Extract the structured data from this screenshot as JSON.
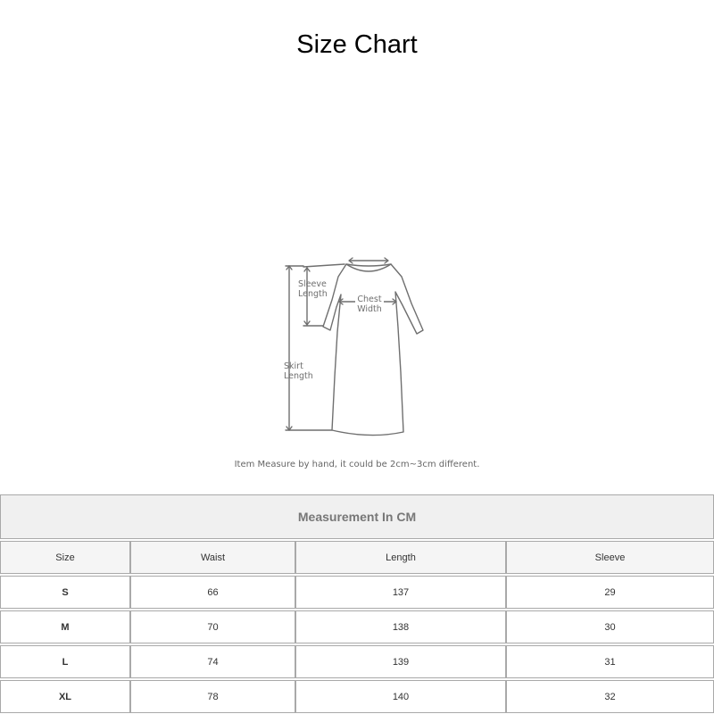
{
  "page": {
    "title": "Size Chart"
  },
  "diagram": {
    "labels": {
      "sleeve_line1": "Sleeve",
      "sleeve_line2": "Length",
      "chest_line1": "Chest",
      "chest_line2": "Width",
      "skirt_line1": "Skirt",
      "skirt_line2": "Length"
    },
    "line_color": "#6f6f6f"
  },
  "note": "Item Measure by hand, it could be 2cm~3cm different.",
  "table": {
    "caption": "Measurement In CM",
    "headers": [
      "Size",
      "Waist",
      "Length",
      "Sleeve"
    ],
    "rows": [
      [
        "S",
        "66",
        "137",
        "29"
      ],
      [
        "M",
        "70",
        "138",
        "30"
      ],
      [
        "L",
        "74",
        "139",
        "31"
      ],
      [
        "XL",
        "78",
        "140",
        "32"
      ]
    ],
    "border_color": "#a9a9a9",
    "header_bg": "#f0f0f0"
  }
}
